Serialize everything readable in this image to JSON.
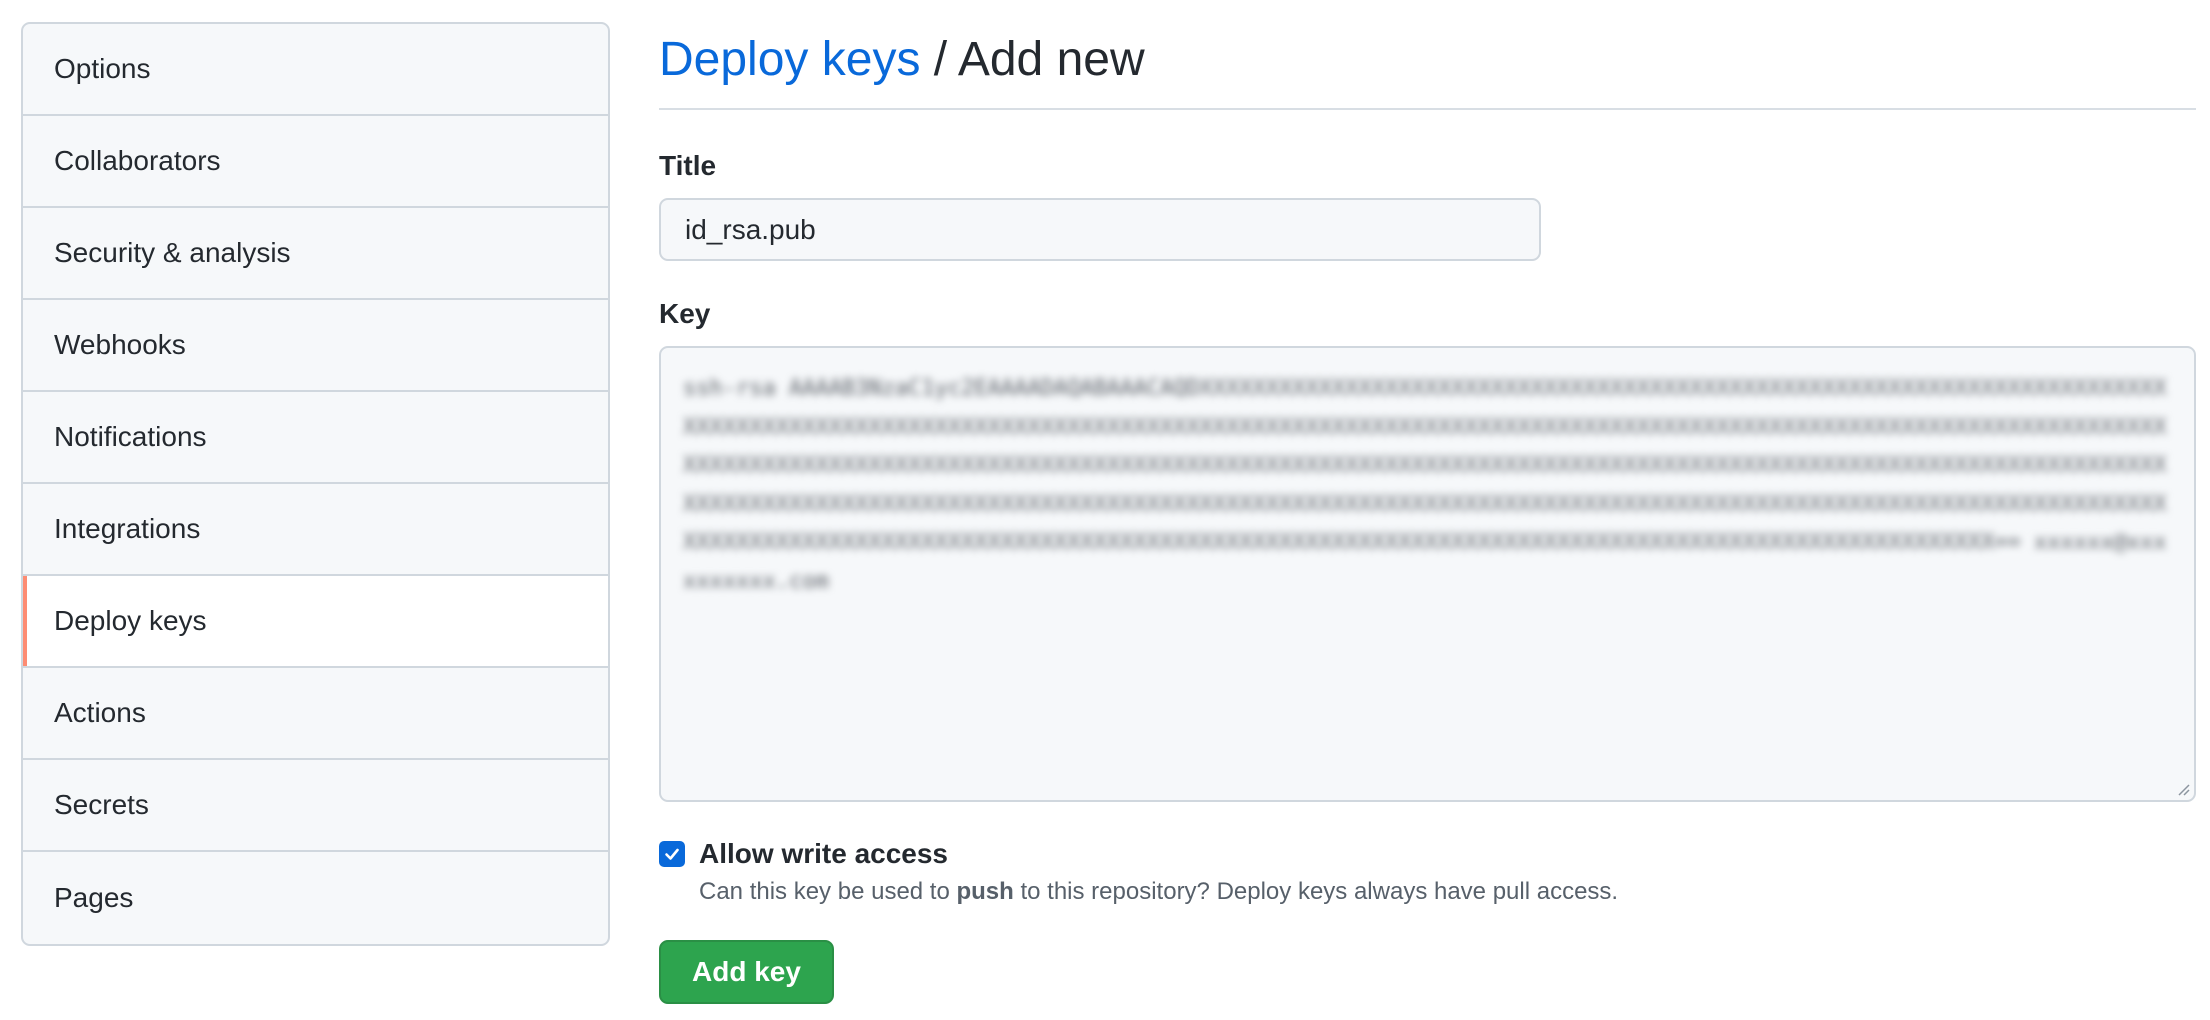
{
  "sidebar": {
    "items": [
      {
        "label": "Options"
      },
      {
        "label": "Collaborators"
      },
      {
        "label": "Security & analysis"
      },
      {
        "label": "Webhooks"
      },
      {
        "label": "Notifications"
      },
      {
        "label": "Integrations"
      },
      {
        "label": "Deploy keys",
        "selected": true
      },
      {
        "label": "Actions"
      },
      {
        "label": "Secrets"
      },
      {
        "label": "Pages"
      }
    ]
  },
  "header": {
    "breadcrumb_link": "Deploy keys",
    "separator": "/",
    "current": "Add new"
  },
  "form": {
    "title_label": "Title",
    "title_value": "id_rsa.pub",
    "key_label": "Key",
    "key_value_obscured": "ssh-rsa AAAAB3NzaC1yc2EAAAADAQABAAACAQDXXXXXXXXXXXXXXXXXXXXXXXXXXXXXXXXXXXXXXXXXXXXXXXXXXXXXXXXXXXXXXXXXXXXXXXXXXXXXXXXXXXXXXXXXXXXXXXXXXXXXXXXXXXXXXXXXXXXXXXXXXXXXXXXXXXXXXXXXXXXXXXXXXXXXXXXXXXXXXXXXXXXXXXXXXXXXXXXXXXXXXXXXXXXXXXXXXXXXXXXXXXXXXXXXXXXXXXXXXXXXXXXXXXXXXXXXXXXXXXXXXXXXXXXXXXXXXXXXXXXXXXXXXXXXXXXXXXXXXXXXXXXXXXXXXXXXXXXXXXXXXXXXXXXXXXXXXXXXXXXXXXXXXXXXXXXXXXXXXXXXXXXXXXXXXXXXXXXXXXXXXXXXXXXXXXXXXXXXXXXXXXXXXXXXXXXXXXXXXXXXXXXXXXXXXXXXXXXXXXXXXXXXXXXXXXXXXXXXXXXXXXXXXXXXXXXXXXXXXXXXXXXXXXXXXXXXXXXXXXXXXXXXXXXXXXXXXXXXXXXXXXXXXXX== xxxxxx@xxxxxxxxxx.com",
    "checkbox_label": "Allow write access",
    "checkbox_checked": true,
    "note_before": "Can this key be used to ",
    "note_bold": "push",
    "note_after": " to this repository? Deploy keys always have pull access.",
    "submit_label": "Add key"
  },
  "colors": {
    "link": "#0969da",
    "primary_button": "#2da44e",
    "selected_indicator": "#fd8c73"
  }
}
